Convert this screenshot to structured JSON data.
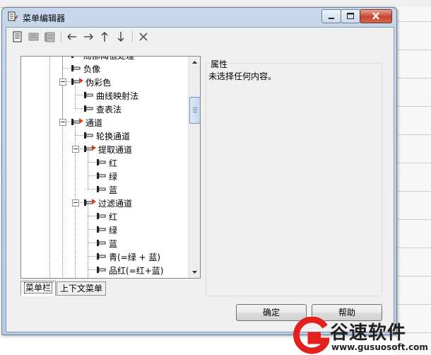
{
  "window": {
    "title": "菜单编辑器"
  },
  "toolbar": {
    "icons": [
      "properties-icon",
      "menu-grey-icon",
      "submenu-grey-icon",
      "arrow-left-icon",
      "arrow-right-icon",
      "arrow-up-icon",
      "arrow-down-icon",
      "delete-icon"
    ]
  },
  "tree": {
    "items": [
      {
        "label": "局部阈值处理",
        "type": "item"
      },
      {
        "label": "负像",
        "type": "item"
      },
      {
        "label": "伪彩色",
        "type": "menu"
      },
      {
        "label": "曲线映射法",
        "type": "item"
      },
      {
        "label": "查表法",
        "type": "item"
      },
      {
        "label": "通道",
        "type": "menu"
      },
      {
        "label": "轮换通道",
        "type": "item"
      },
      {
        "label": "提取通道",
        "type": "menu"
      },
      {
        "label": "红",
        "type": "item"
      },
      {
        "label": "绿",
        "type": "item"
      },
      {
        "label": "蓝",
        "type": "item"
      },
      {
        "label": "过滤通道",
        "type": "menu"
      },
      {
        "label": "红",
        "type": "item"
      },
      {
        "label": "绿",
        "type": "item"
      },
      {
        "label": "蓝",
        "type": "item"
      },
      {
        "label": "青(=绿 + 蓝)",
        "type": "item"
      },
      {
        "label": "品红(=红+蓝)",
        "type": "item"
      }
    ]
  },
  "tabs": [
    {
      "label": "菜单栏",
      "active": true
    },
    {
      "label": "上下文菜单",
      "active": false
    }
  ],
  "properties": {
    "title": "属性",
    "empty_text": "未选择任何内容。"
  },
  "buttons": {
    "ok": "确定",
    "help": "帮助"
  },
  "watermark": {
    "brand": "谷速软件",
    "url": "www.gusuosoft.com"
  },
  "colors": {
    "accent": "#d04020",
    "brand_red": "#e3211c",
    "tree_line": "#999999"
  }
}
